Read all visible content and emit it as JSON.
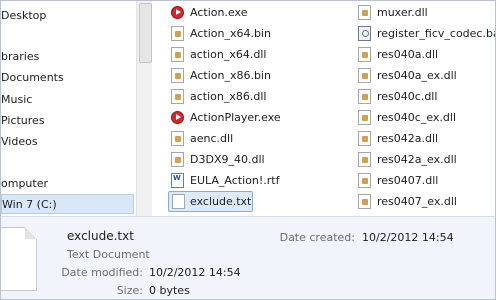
{
  "nav": {
    "items": [
      {
        "label": "Desktop",
        "selected": false
      },
      {
        "label": "braries",
        "selected": false
      },
      {
        "label": "Documents",
        "selected": false
      },
      {
        "label": "Music",
        "selected": false
      },
      {
        "label": "Pictures",
        "selected": false
      },
      {
        "label": "Videos",
        "selected": false
      },
      {
        "label": "omputer",
        "selected": false
      },
      {
        "label": "Win 7 (C:)",
        "selected": true
      }
    ]
  },
  "files": {
    "col1": [
      {
        "name": "Action.exe",
        "icon": "action-exe-icon"
      },
      {
        "name": "Action_x64.bin",
        "icon": "bin-file-icon"
      },
      {
        "name": "action_x64.dll",
        "icon": "dll-file-icon"
      },
      {
        "name": "Action_x86.bin",
        "icon": "bin-file-icon"
      },
      {
        "name": "action_x86.dll",
        "icon": "dll-file-icon"
      },
      {
        "name": "ActionPlayer.exe",
        "icon": "actionplayer-exe-icon"
      },
      {
        "name": "aenc.dll",
        "icon": "dll-file-icon"
      },
      {
        "name": "D3DX9_40.dll",
        "icon": "dll-file-icon"
      },
      {
        "name": "EULA_Action!.rtf",
        "icon": "rtf-file-icon"
      },
      {
        "name": "exclude.txt",
        "icon": "text-file-icon",
        "selected": true
      }
    ],
    "col2": [
      {
        "name": "muxer.dll",
        "icon": "dll-file-icon"
      },
      {
        "name": "register_ficv_codec.bat",
        "icon": "bat-file-icon"
      },
      {
        "name": "res040a.dll",
        "icon": "dll-file-icon"
      },
      {
        "name": "res040a_ex.dll",
        "icon": "dll-file-icon"
      },
      {
        "name": "res040c.dll",
        "icon": "dll-file-icon"
      },
      {
        "name": "res040c_ex.dll",
        "icon": "dll-file-icon"
      },
      {
        "name": "res042a.dll",
        "icon": "dll-file-icon"
      },
      {
        "name": "res042a_ex.dll",
        "icon": "dll-file-icon"
      },
      {
        "name": "res0407.dll",
        "icon": "dll-file-icon"
      },
      {
        "name": "res0407_ex.dll",
        "icon": "dll-file-icon"
      }
    ]
  },
  "details": {
    "title": "exclude.txt",
    "type": "Text Document",
    "date_modified_label": "Date modified:",
    "date_modified": "10/2/2012 14:54",
    "size_label": "Size:",
    "size": "0 bytes",
    "date_created_label": "Date created:",
    "date_created": "10/2/2012 14:54"
  },
  "colors": {
    "selection_bg": "#dcebfc",
    "selection_border": "#84acdd",
    "details_bg": "#f1f5fb"
  }
}
